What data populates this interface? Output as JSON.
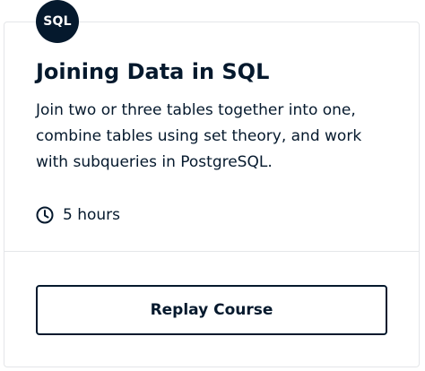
{
  "course": {
    "badge_text": "SQL",
    "title": "Joining Data in SQL",
    "description": "Join two or three tables together into one, combine tables using set theory, and work with subqueries in PostgreSQL.",
    "duration": "5 hours",
    "duration_icon": "clock-icon",
    "action_label": "Replay Course"
  },
  "colors": {
    "primary": "#05192d",
    "border": "#e4e6e9",
    "background": "#ffffff"
  }
}
